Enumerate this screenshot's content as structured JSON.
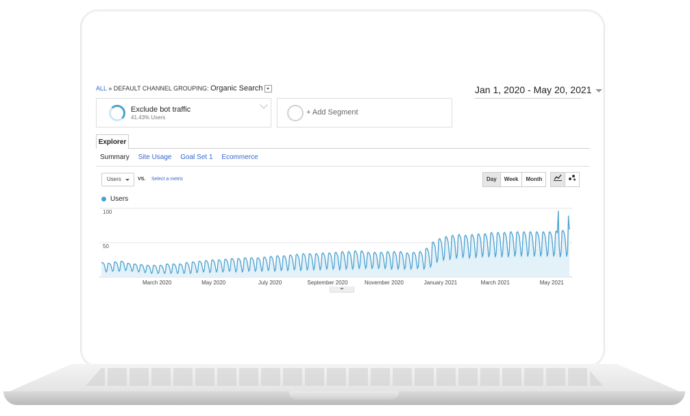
{
  "breadcrumb": {
    "all": "ALL",
    "sep": "»",
    "group_label": "DEFAULT CHANNEL GROUPING:",
    "selected": "Organic Search"
  },
  "date_range": "Jan 1, 2020 - May 20, 2021",
  "segments": [
    {
      "title": "Exclude bot traffic",
      "subtitle": "41.43% Users"
    },
    {
      "title": "+ Add Segment"
    }
  ],
  "tabs": {
    "explorer": "Explorer"
  },
  "subtabs": [
    "Summary",
    "Site Usage",
    "Goal Set 1",
    "Ecommerce"
  ],
  "metric_selector": {
    "value": "Users",
    "vs": "VS.",
    "select": "Select a metric"
  },
  "period_buttons": [
    "Day",
    "Week",
    "Month"
  ],
  "selected_period": "Day",
  "icons": {
    "line_chart": "line-chart-icon",
    "motion_chart": "motion-chart-icon"
  },
  "colors": {
    "series": "#4aa0cf",
    "link": "#3366cc"
  },
  "chart_data": {
    "type": "area",
    "legend": "Users",
    "ylim": [
      0,
      100
    ],
    "yticks": [
      100,
      50
    ],
    "xticks": [
      "March 2020",
      "May 2020",
      "July 2020",
      "September 2020",
      "November 2020",
      "January 2021",
      "March 2021",
      "May 2021"
    ],
    "x_start": "2020-01-01",
    "x_end": "2021-05-20",
    "series": [
      {
        "name": "Users",
        "weekly_mean": [
          14,
          14,
          15,
          16,
          14,
          13,
          12,
          11,
          11,
          11,
          12,
          12,
          12,
          13,
          14,
          15,
          15,
          16,
          16,
          17,
          17,
          17,
          18,
          18,
          18,
          19,
          19,
          20,
          20,
          21,
          21,
          22,
          22,
          22,
          23,
          23,
          23,
          24,
          24,
          25,
          25,
          24,
          24,
          24,
          24,
          24,
          24,
          23,
          24,
          24,
          28,
          36,
          40,
          42,
          44,
          45,
          44,
          45,
          46,
          46,
          47,
          47,
          47,
          48,
          48,
          48,
          48,
          48,
          48,
          48,
          48,
          49,
          49,
          50
        ],
        "weekly_amplitude": [
          7,
          6,
          7,
          7,
          6,
          6,
          6,
          6,
          6,
          6,
          7,
          7,
          7,
          8,
          8,
          8,
          9,
          9,
          9,
          9,
          10,
          10,
          10,
          10,
          10,
          10,
          11,
          11,
          11,
          11,
          12,
          12,
          12,
          12,
          12,
          12,
          13,
          13,
          13,
          13,
          13,
          12,
          12,
          12,
          13,
          13,
          13,
          12,
          12,
          13,
          14,
          15,
          16,
          17,
          17,
          17,
          17,
          17,
          17,
          17,
          18,
          18,
          18,
          18,
          18,
          18,
          18,
          18,
          18,
          18,
          19,
          19,
          20,
          20
        ]
      }
    ]
  }
}
